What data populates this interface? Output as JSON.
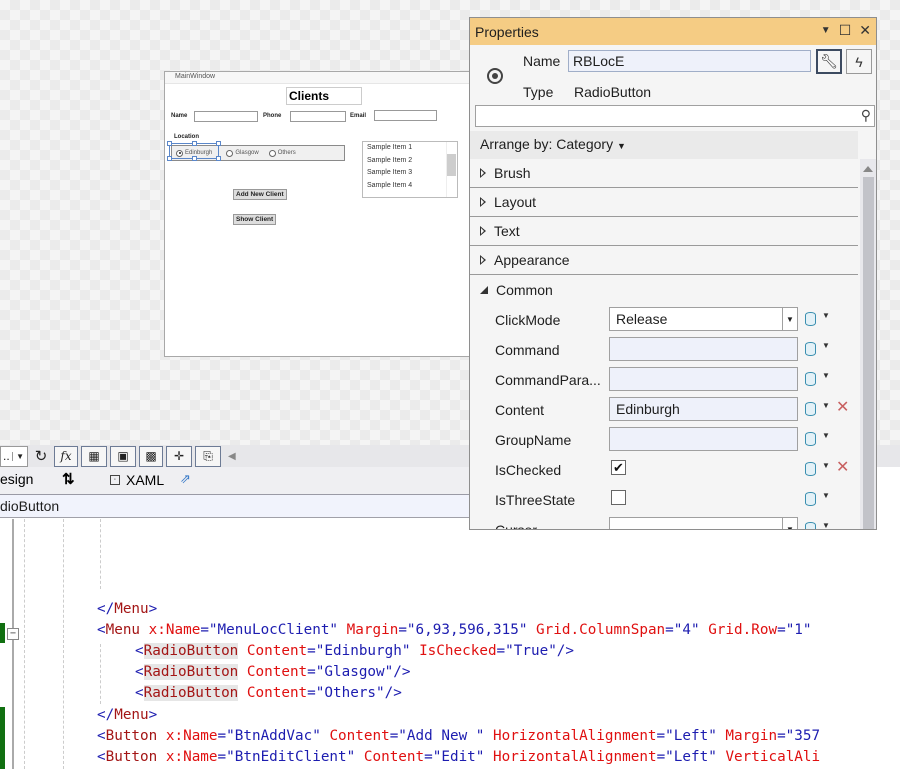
{
  "designer": {
    "window_title": "MainWindow",
    "heading": "Clients",
    "labels": {
      "name": "Name",
      "phone": "Phone",
      "email": "Email",
      "location": "Location"
    },
    "radio_options": [
      {
        "label": "Edinburgh",
        "checked": true
      },
      {
        "label": "Glasgow",
        "checked": false
      },
      {
        "label": "Others",
        "checked": false
      }
    ],
    "list_items": [
      "Sample Item 1",
      "Sample Item 2",
      "Sample Item 3",
      "Sample Item 4"
    ],
    "buttons": {
      "add": "Add New Client",
      "show": "Show Client"
    }
  },
  "properties": {
    "title": "Properties",
    "name_label": "Name",
    "name_value": "RBLocE",
    "type_label": "Type",
    "type_value": "RadioButton",
    "search_placeholder": "",
    "arrange_by": "Arrange by: Category",
    "categories": [
      "Brush",
      "Layout",
      "Text",
      "Appearance"
    ],
    "expanded_category": "Common",
    "common": {
      "clickmode_label": "ClickMode",
      "clickmode_value": "Release",
      "command_label": "Command",
      "command_value": "",
      "commandparam_label": "CommandPara...",
      "commandparam_value": "",
      "content_label": "Content",
      "content_value": "Edinburgh",
      "groupname_label": "GroupName",
      "groupname_value": "",
      "ischecked_label": "IsChecked",
      "ischecked_value": true,
      "isthreestate_label": "IsThreeState",
      "isthreestate_value": false,
      "cursor_label": "Cursor",
      "cursor_value": ""
    }
  },
  "toolbar": {
    "zoom_value": "..",
    "tabs": {
      "design": "esign",
      "swap": "⇅",
      "xaml": "XAML"
    },
    "breadcrumb": "dioButton"
  },
  "code": {
    "lines": [
      "</Menu>",
      "<Menu x:Name=\"MenuLocClient\" Margin=\"6,93,596,315\" Grid.ColumnSpan=\"4\" Grid.Row=\"1\"",
      "<RadioButton Content=\"Edinburgh\" IsChecked=\"True\"/>",
      "<RadioButton Content=\"Glasgow\"/>",
      "<RadioButton Content=\"Others\"/>",
      "</Menu>",
      "<Button x:Name=\"BtnAddVac\" Content=\"Add New \" HorizontalAlignment=\"Left\" Margin=\"357",
      "<Button x:Name=\"BtnEditClient\" Content=\"Edit\" HorizontalAlignment=\"Left\" VerticalAli"
    ]
  }
}
